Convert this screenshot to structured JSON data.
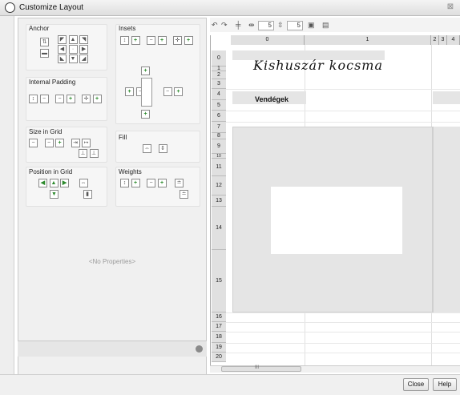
{
  "window": {
    "title": "Customize Layout",
    "close_glyph": "⊠"
  },
  "panel": {
    "anchor": "Anchor",
    "insets": "Insets",
    "internal_padding": "Internal Padding",
    "size_in_grid": "Size in Grid",
    "fill": "Fill",
    "position_in_grid": "Position in Grid",
    "weights": "Weights",
    "no_properties": "<No Properties>"
  },
  "toolbar": {
    "hgap_value": "5",
    "vgap_value": "5"
  },
  "grid": {
    "columns": [
      "0",
      "1",
      "2",
      "3",
      "4"
    ],
    "rows": [
      "0",
      "1",
      "2",
      "3",
      "4",
      "5",
      "6",
      "7",
      "8",
      "9",
      "10",
      "11",
      "12",
      "13",
      "14",
      "15",
      "16",
      "17",
      "18",
      "19",
      "20"
    ],
    "title_label": "Kishuszár kocsma",
    "guests_label": "Vendégek"
  },
  "scroll": {
    "thumb_label": "III"
  },
  "buttons": {
    "close": "Close",
    "help": "Help"
  },
  "icons": [
    "anchor-icon",
    "insets-icon",
    "padding-icon",
    "fill-icon",
    "weight-icon",
    "undo-icon",
    "redo-icon"
  ]
}
